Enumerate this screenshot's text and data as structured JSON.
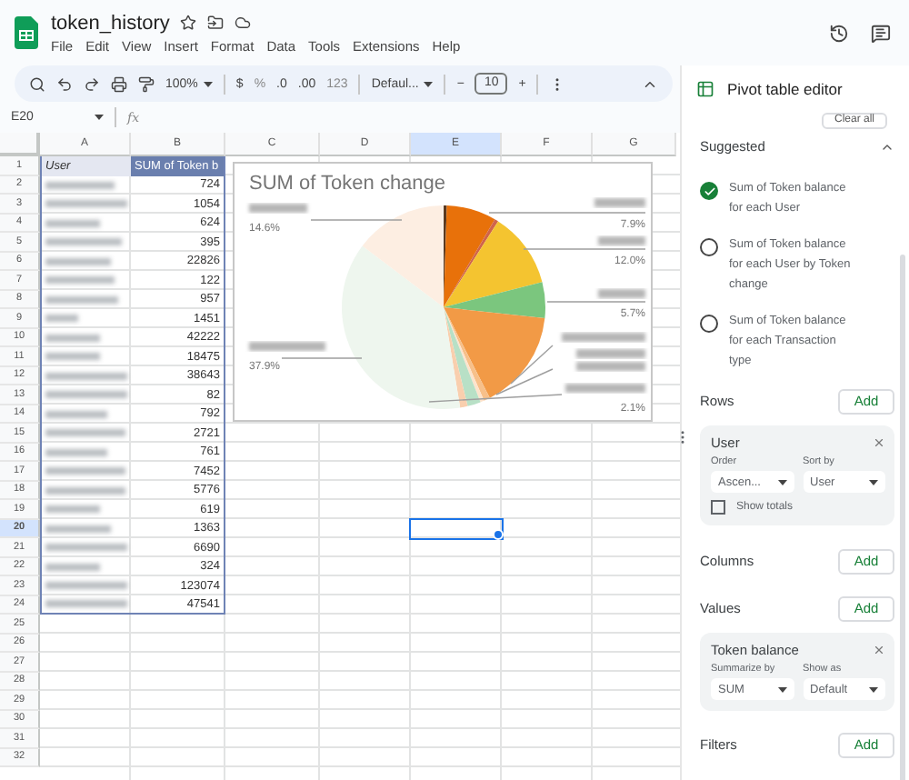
{
  "file": {
    "title": "token_history"
  },
  "menu": [
    "File",
    "Edit",
    "View",
    "Insert",
    "Format",
    "Data",
    "Tools",
    "Extensions",
    "Help"
  ],
  "toolbar": {
    "zoom": "100%",
    "currency": "$",
    "percent": "%",
    "decimals_less": ".0",
    "decimals_more": ".00",
    "number_format": "123",
    "font": "Defaul...",
    "decrease": "−",
    "font_size": "10",
    "increase": "+"
  },
  "formula_bar": {
    "cell": "E20",
    "fx": "fx"
  },
  "sheet": {
    "columns": [
      {
        "label": "A",
        "selected": false
      },
      {
        "label": "B",
        "selected": false
      },
      {
        "label": "C",
        "selected": false
      },
      {
        "label": "D",
        "selected": false
      },
      {
        "label": "E",
        "selected": true
      },
      {
        "label": "F",
        "selected": false
      },
      {
        "label": "G",
        "selected": false
      }
    ],
    "rows": [
      {
        "label": "1",
        "selected": false
      },
      {
        "label": "2",
        "selected": false
      },
      {
        "label": "3",
        "selected": false
      },
      {
        "label": "4",
        "selected": false
      },
      {
        "label": "5",
        "selected": false
      },
      {
        "label": "6",
        "selected": false
      },
      {
        "label": "7",
        "selected": false
      },
      {
        "label": "8",
        "selected": false
      },
      {
        "label": "9",
        "selected": false
      },
      {
        "label": "10",
        "selected": false
      },
      {
        "label": "11",
        "selected": false
      },
      {
        "label": "12",
        "selected": false
      },
      {
        "label": "13",
        "selected": false
      },
      {
        "label": "14",
        "selected": false
      },
      {
        "label": "15",
        "selected": false
      },
      {
        "label": "16",
        "selected": false
      },
      {
        "label": "17",
        "selected": false
      },
      {
        "label": "18",
        "selected": false
      },
      {
        "label": "19",
        "selected": false
      },
      {
        "label": "20",
        "selected": true
      },
      {
        "label": "21",
        "selected": false
      },
      {
        "label": "22",
        "selected": false
      },
      {
        "label": "23",
        "selected": false
      },
      {
        "label": "24",
        "selected": false
      },
      {
        "label": "25",
        "selected": false
      },
      {
        "label": "26",
        "selected": false
      },
      {
        "label": "27",
        "selected": false
      },
      {
        "label": "28",
        "selected": false
      },
      {
        "label": "29",
        "selected": false
      },
      {
        "label": "30",
        "selected": false
      },
      {
        "label": "31",
        "selected": false
      },
      {
        "label": "32",
        "selected": false
      }
    ]
  },
  "pivot": {
    "headers": [
      "User",
      "SUM of Token b"
    ],
    "values": [
      "724",
      "1054",
      "624",
      "395",
      "22826",
      "122",
      "957",
      "1451",
      "42222",
      "18475",
      "38643",
      "82",
      "792",
      "2721",
      "761",
      "7452",
      "5776",
      "619",
      "1363",
      "6690",
      "324",
      "123074",
      "47541"
    ]
  },
  "chart": {
    "title": "SUM of Token change",
    "labels": [
      "14.6%",
      "37.9%",
      "7.9%",
      "12.0%",
      "5.7%",
      "2.1%"
    ]
  },
  "editor": {
    "title": "Pivot table editor",
    "clear_all": "Clear all",
    "suggested": {
      "label": "Suggested",
      "expanded": true,
      "items": [
        {
          "text": "Sum of Token balance for each User",
          "selected": true
        },
        {
          "text": "Sum of Token balance for each User by Token change",
          "selected": false
        },
        {
          "text": "Sum of Token balance for each Transaction type",
          "selected": false
        }
      ]
    },
    "sections": [
      {
        "kind": "rows",
        "label": "Rows",
        "add": "Add",
        "field": {
          "name": "User",
          "order_label": "Order",
          "order": "Ascen...",
          "sort_label": "Sort by",
          "sort": "User",
          "totals_label": "Show totals",
          "show_totals": false
        }
      },
      {
        "kind": "columns",
        "label": "Columns",
        "add": "Add"
      },
      {
        "kind": "values",
        "label": "Values",
        "add": "Add",
        "field": {
          "name": "Token balance",
          "summarize_label": "Summarize by",
          "summarize": "SUM",
          "show_as_label": "Show as",
          "show_as": "Default"
        }
      },
      {
        "kind": "filters",
        "label": "Filters",
        "add": "Add"
      }
    ]
  }
}
